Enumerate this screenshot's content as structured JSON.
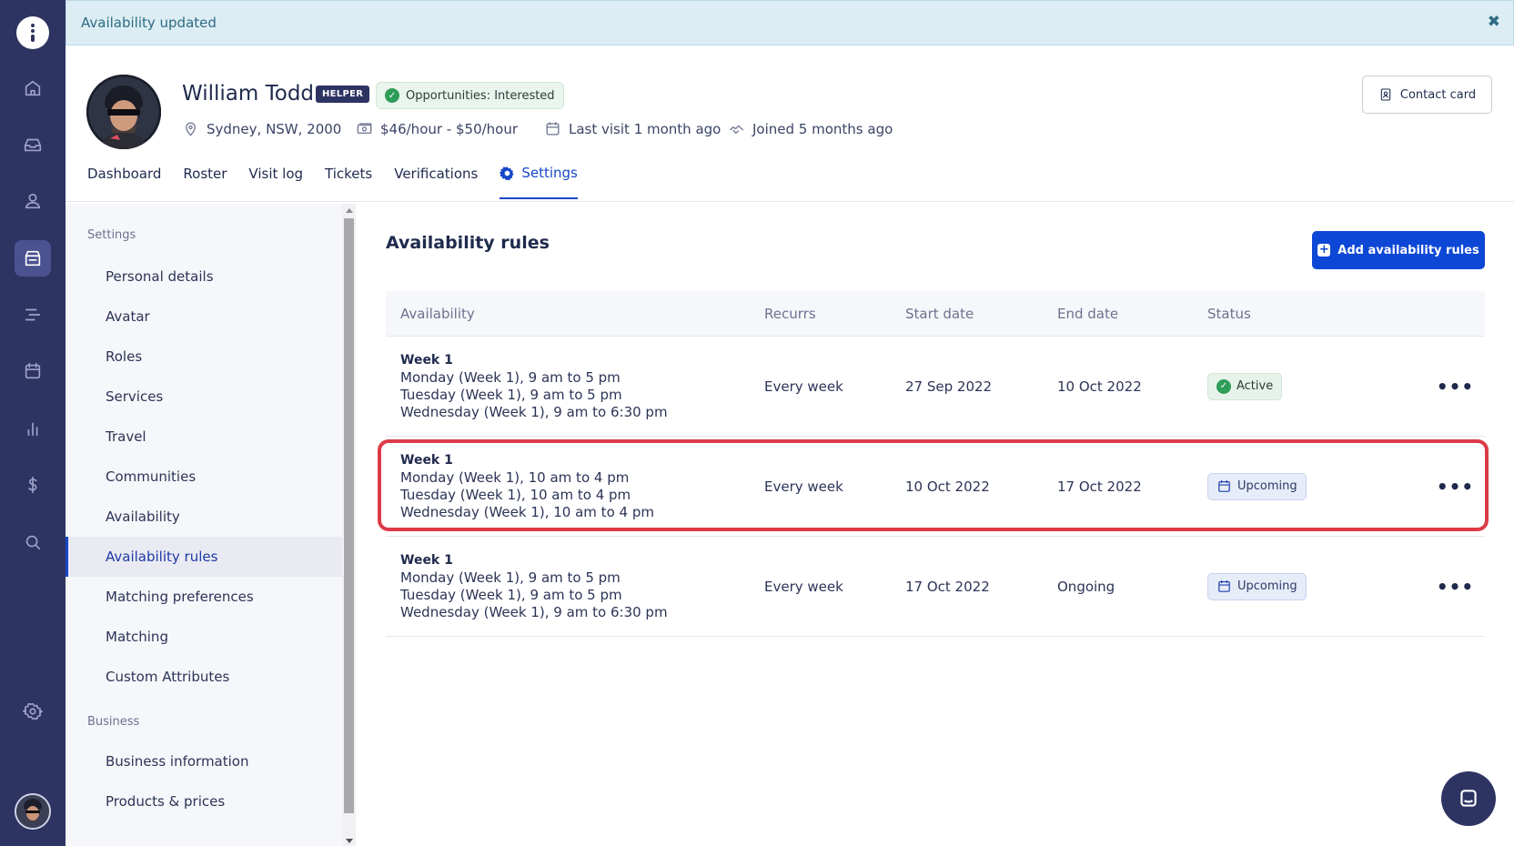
{
  "banner": {
    "message": "Availability updated",
    "close_glyph": "✖"
  },
  "profile": {
    "name": "William Todd",
    "role_badge": "HELPER",
    "opportunities": "Opportunities: Interested",
    "location": "Sydney, NSW, 2000",
    "rate": "$46/hour - $50/hour",
    "last_visit": "Last visit 1 month ago",
    "joined": "Joined 5 months ago",
    "contact_button": "Contact card"
  },
  "tabs": [
    {
      "label": "Dashboard"
    },
    {
      "label": "Roster"
    },
    {
      "label": "Visit log"
    },
    {
      "label": "Tickets"
    },
    {
      "label": "Verifications"
    },
    {
      "label": "Settings",
      "active": true
    }
  ],
  "sidebar": {
    "groups": [
      {
        "label": "Settings",
        "items": [
          {
            "label": "Personal details"
          },
          {
            "label": "Avatar"
          },
          {
            "label": "Roles"
          },
          {
            "label": "Services"
          },
          {
            "label": "Travel"
          },
          {
            "label": "Communities"
          },
          {
            "label": "Availability"
          },
          {
            "label": "Availability rules",
            "active": true
          },
          {
            "label": "Matching preferences"
          },
          {
            "label": "Matching"
          },
          {
            "label": "Custom Attributes"
          }
        ]
      },
      {
        "label": "Business",
        "items": [
          {
            "label": "Business information"
          },
          {
            "label": "Products & prices"
          }
        ]
      }
    ]
  },
  "main": {
    "title": "Availability rules",
    "add_button": "Add availability rules",
    "columns": [
      "Availability",
      "Recurrs",
      "Start date",
      "End date",
      "Status"
    ],
    "rows": [
      {
        "week": "Week 1",
        "lines": [
          "Monday (Week 1), 9 am to 5 pm",
          "Tuesday (Week 1), 9 am to 5 pm",
          "Wednesday (Week 1), 9 am to 6:30 pm"
        ],
        "recurs": "Every week",
        "start": "27 Sep 2022",
        "end": "10 Oct 2022",
        "status": "Active",
        "status_kind": "active",
        "status_icon": "check-circle-icon"
      },
      {
        "week": "Week 1",
        "lines": [
          "Monday (Week 1), 10 am to 4 pm",
          "Tuesday (Week 1), 10 am to 4 pm",
          "Wednesday (Week 1), 10 am to 4 pm"
        ],
        "recurs": "Every week",
        "start": "10 Oct 2022",
        "end": "17 Oct 2022",
        "status": "Upcoming",
        "status_kind": "upcoming",
        "status_icon": "calendar-icon",
        "highlighted": true
      },
      {
        "week": "Week 1",
        "lines": [
          "Monday (Week 1), 9 am to 5 pm",
          "Tuesday (Week 1), 9 am to 5 pm",
          "Wednesday (Week 1), 9 am to 6:30 pm"
        ],
        "recurs": "Every week",
        "start": "17 Oct 2022",
        "end": "Ongoing",
        "status": "Upcoming",
        "status_kind": "upcoming",
        "status_icon": "calendar-icon"
      }
    ],
    "row_menu_glyph": "•••"
  },
  "colors": {
    "rail": "#2e3462",
    "accent": "#1647c7",
    "button": "#0d47d6",
    "highlight": "#dd3a48",
    "banner": "#dcedf3"
  },
  "rail_icons": [
    "home-icon",
    "inbox-icon",
    "user-icon",
    "store-icon",
    "timeline-icon",
    "calendar-icon",
    "chart-icon",
    "dollar-icon",
    "search-icon",
    "settings-icon"
  ]
}
